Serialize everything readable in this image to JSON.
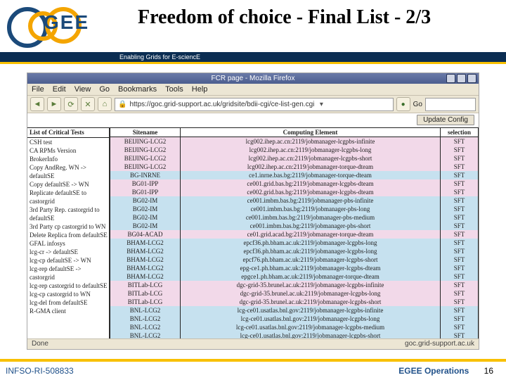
{
  "slide": {
    "title": "Freedom of choice - Final List - 2/3",
    "tagline": "Enabling Grids for E-sciencE",
    "logo_text": "GEE",
    "footer_left": "INFSO-RI-508833",
    "footer_right": "EGEE Operations",
    "page_num": "16"
  },
  "browser": {
    "window_title": "FCR page - Mozilla Firefox",
    "menus": [
      "File",
      "Edit",
      "View",
      "Go",
      "Bookmarks",
      "Tools",
      "Help"
    ],
    "nav": {
      "back": "◄",
      "fwd": "►",
      "reload": "⟳",
      "stop": "✕",
      "home": "⌂",
      "go": "Go",
      "search_icon": "G"
    },
    "address": "https://goc.grid-support.ac.uk/gridsite/bdii-cgi/ce-list-gen.cgi",
    "status_left": "Done",
    "status_right": "goc.grid-support.ac.uk",
    "update_btn": "Update Config"
  },
  "left_panel": {
    "header": "List of Critical Tests",
    "items": [
      "CSH test",
      "CA RPMs Version",
      "BrokerInfo",
      "Copy AndReg. WN -> defaultSE",
      "Copy defaultSE -> WN",
      "Replicate defaultSE to castorgrid",
      "3rd Party Rep. castorgrid to defaultSE",
      "3rd Party cp castorgrid to WN",
      "Delete Replica from defaultSE",
      "GFAL infosys",
      "lcg-cr -> defaultSE",
      "lcg-cp defaultSE -> WN",
      "lcg-rep defaultSE -> castorgrid",
      "lcg-rep castorgrid to defaultSE",
      "lcg-cp castorgrid to WN",
      "lcg-del from defaultSE",
      "R-GMA client"
    ]
  },
  "grid": {
    "cols": [
      "Sitename",
      "Computing Element",
      "selection"
    ],
    "rows": [
      {
        "c": "pink",
        "s": "BEIJING-LCG2",
        "ce": "lcg002.ihep.ac.cn:2119/jobmanager-lcgpbs-infinite",
        "sel": "SFT"
      },
      {
        "c": "pink",
        "s": "BEIJING-LCG2",
        "ce": "lcg002.ihep.ac.cn:2119/jobmanager-lcgpbs-long",
        "sel": "SFT"
      },
      {
        "c": "pink",
        "s": "BEIJING-LCG2",
        "ce": "lcg002.ihep.ac.cn:2119/jobmanager-lcgpbs-short",
        "sel": "SFT"
      },
      {
        "c": "pink",
        "s": "BEIJING-LCG2",
        "ce": "lcg002.ihep.ac.cn:2119/jobmanager-torque-dteam",
        "sel": "SFT"
      },
      {
        "c": "blue",
        "s": "BG-INRNE",
        "ce": "ce1.inrne.bas.bg:2119/jobmanager-torque-dteam",
        "sel": "SFT"
      },
      {
        "c": "pink",
        "s": "BG01-IPP",
        "ce": "ce001.grid.bas.bg:2119/jobmanager-lcgpbs-dteam",
        "sel": "SFT"
      },
      {
        "c": "pink",
        "s": "BG01-IPP",
        "ce": "ce002.grid.bas.bg:2119/jobmanager-lcgpbs-dteam",
        "sel": "SFT"
      },
      {
        "c": "blue",
        "s": "BG02-IM",
        "ce": "ce001.imbm.bas.bg:2119/jobmanager-pbs-infinite",
        "sel": "SFT"
      },
      {
        "c": "blue",
        "s": "BG02-IM",
        "ce": "ce001.imbm.bas.bg:2119/jobmanager-pbs-long",
        "sel": "SFT"
      },
      {
        "c": "blue",
        "s": "BG02-IM",
        "ce": "ce001.imbm.bas.bg:2119/jobmanager-pbs-medium",
        "sel": "SFT"
      },
      {
        "c": "blue",
        "s": "BG02-IM",
        "ce": "ce001.imbm.bas.bg:2119/jobmanager-pbs-short",
        "sel": "SFT"
      },
      {
        "c": "pink",
        "s": "BG04-ACAD",
        "ce": "ce01.grid.acad.bg:2119/jobmanager-torque-dteam",
        "sel": "SFT"
      },
      {
        "c": "blue",
        "s": "BHAM-LCG2",
        "ce": "epcf36.ph.bham.ac.uk:2119/jobmanager-lcgpbs-long",
        "sel": "SFT"
      },
      {
        "c": "blue",
        "s": "BHAM-LCG2",
        "ce": "epcf36.ph.bham.ac.uk:2119/jobmanager-lcgpbs-long",
        "sel": "SFT"
      },
      {
        "c": "blue",
        "s": "BHAM-LCG2",
        "ce": "epcf76.ph.bham.ac.uk:2119/jobmanager-lcgpbs-short",
        "sel": "SFT"
      },
      {
        "c": "blue",
        "s": "BHAM-LCG2",
        "ce": "epg-ce1.ph.bham.ac.uk:2119/jobmanager-lcgpbs-dteam",
        "sel": "SFT"
      },
      {
        "c": "blue",
        "s": "BHAM-LCG2",
        "ce": "epgce1.ph.bham.ac.uk:2119/jobmanager-torque-dteam",
        "sel": "SFT"
      },
      {
        "c": "pink",
        "s": "BITLab-LCG",
        "ce": "dgc-grid-35.brunel.ac.uk:2119/jobmanager-lcgpbs-infinite",
        "sel": "SFT"
      },
      {
        "c": "pink",
        "s": "BITLab-LCG",
        "ce": "dgc-grid-35.brunel.ac.uk:2119/jobmanager-lcgpbs-long",
        "sel": "SFT"
      },
      {
        "c": "pink",
        "s": "BITLab-LCG",
        "ce": "dgc-grid-35.brunel.ac.uk:2119/jobmanager-lcgpbs-short",
        "sel": "SFT"
      },
      {
        "c": "blue",
        "s": "BNL-LCG2",
        "ce": "lcg-ce01.usatlas.bnl.gov:2119/jobmanager-lcgpbs-infinite",
        "sel": "SFT"
      },
      {
        "c": "blue",
        "s": "BNL-LCG2",
        "ce": "lcg-ce01.usatlas.bnl.gov:2119/jobmanager-lcgpbs-long",
        "sel": "SFT"
      },
      {
        "c": "blue",
        "s": "BNL-LCG2",
        "ce": "lcg-ce01.usatlas.bnl.gov:2119/jobmanager-lcgpbs-medium",
        "sel": "SFT"
      },
      {
        "c": "blue",
        "s": "BNL-LCG2",
        "ce": "lcg-ce01.usatlas.bnl.gov:2119/jobmanager-lcgpbs-short",
        "sel": "SFT"
      }
    ]
  }
}
